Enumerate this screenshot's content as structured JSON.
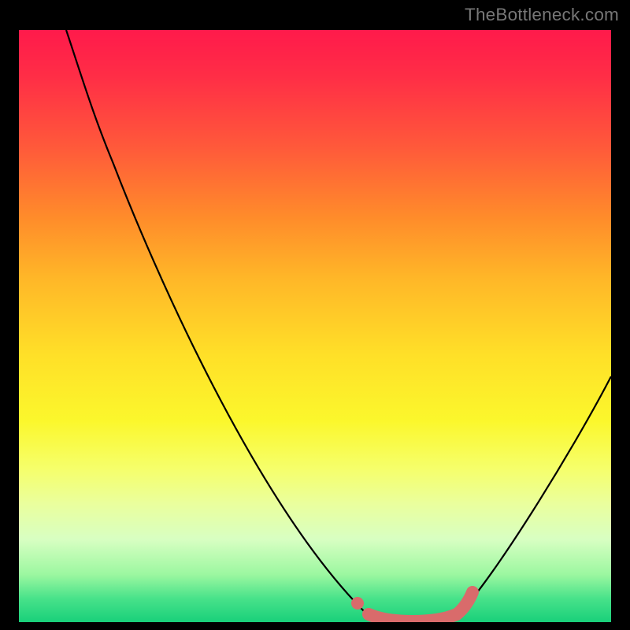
{
  "watermark": "TheBottleneck.com",
  "chart_data": {
    "type": "line",
    "title": "",
    "xlabel": "",
    "ylabel": "",
    "x": [
      0.08,
      0.12,
      0.16,
      0.22,
      0.3,
      0.4,
      0.5,
      0.58,
      0.62,
      0.66,
      0.7,
      0.74,
      0.8,
      0.88,
      0.95,
      1.0
    ],
    "values": [
      1.0,
      0.9,
      0.78,
      0.6,
      0.42,
      0.22,
      0.08,
      0.02,
      0.005,
      0.0,
      0.0,
      0.005,
      0.03,
      0.12,
      0.3,
      0.42
    ],
    "series": [
      {
        "name": "bottleneck-curve",
        "x_ref": "x",
        "values_ref": "values",
        "stroke": "#000000"
      },
      {
        "name": "highlight",
        "x": [
          0.57,
          0.59,
          0.62,
          0.66,
          0.7,
          0.74,
          0.765
        ],
        "values": [
          0.03,
          0.015,
          0.005,
          0.0,
          0.0,
          0.01,
          0.05
        ],
        "stroke": "#d96b6b",
        "stroke_width": 16
      }
    ],
    "xlim": [
      0,
      1
    ],
    "ylim": [
      0,
      1
    ],
    "grid": false,
    "legend": false,
    "background_gradient_top": "#ff1a4b",
    "background_gradient_bottom": "#19d07a"
  },
  "colors": {
    "page_bg": "#000000",
    "watermark": "#777777",
    "curve": "#000000",
    "highlight": "#d96b6b"
  }
}
